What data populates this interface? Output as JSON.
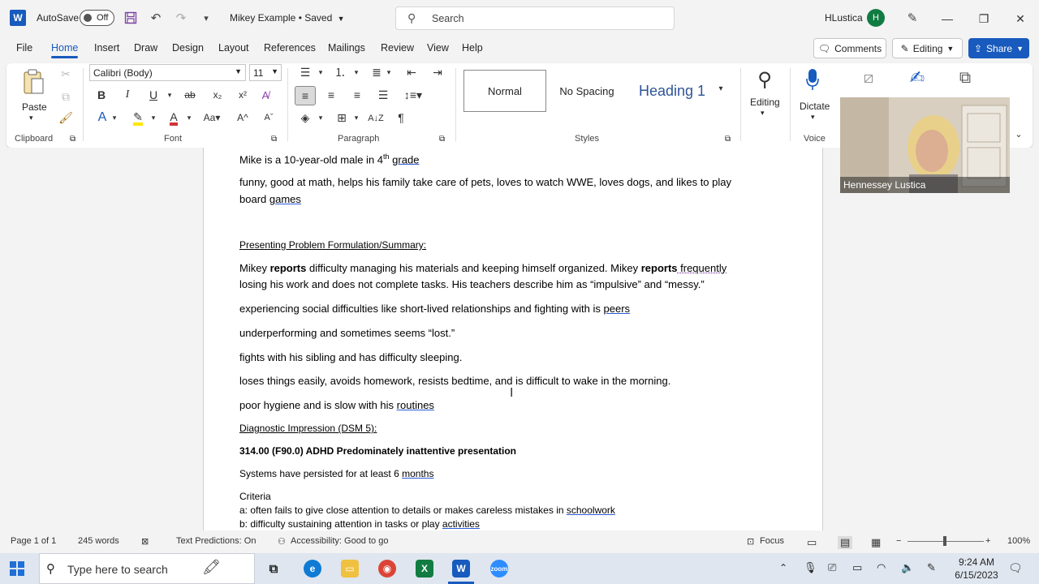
{
  "titlebar": {
    "app_icon": "W",
    "autosave_label": "AutoSave",
    "autosave_state": "Off",
    "doc_title": "Mikey Example • Saved",
    "search_placeholder": "Search",
    "user_name": "HLustica",
    "user_initial": "H"
  },
  "tabs": [
    "File",
    "Home",
    "Insert",
    "Draw",
    "Design",
    "Layout",
    "References",
    "Mailings",
    "Review",
    "View",
    "Help"
  ],
  "active_tab": "Home",
  "actions": {
    "comments": "Comments",
    "editing": "Editing",
    "share": "Share"
  },
  "ribbon": {
    "clipboard": {
      "label": "Clipboard",
      "paste": "Paste"
    },
    "font": {
      "label": "Font",
      "family": "Calibri (Body)",
      "size": "11"
    },
    "paragraph": {
      "label": "Paragraph"
    },
    "styles": {
      "label": "Styles",
      "items": [
        "Normal",
        "No Spacing",
        "Heading 1"
      ]
    },
    "editing": {
      "label": "Editing"
    },
    "voice": {
      "label": "Voice",
      "dictate": "Dictate"
    }
  },
  "document": {
    "line1_pre": "Mike is a 10-year-old male in 4",
    "line1_sup": "th",
    "line1_post": "grade",
    "line2a": "funny, good at math, helps his family take care of pets, loves to watch WWE, loves dogs, and likes to play",
    "line2b_pre": "board ",
    "line2b_sq": "games",
    "heading_presenting": "Presenting Problem Formulation/Summary:",
    "p1_a": "Mikey ",
    "p1_b": "reports",
    "p1_c": " difficulty managing his materials and keeping himself organized. Mikey ",
    "p1_d": "reports",
    "p1_e": " frequently",
    "p1_line2": "losing his work and does not complete tasks. His teachers describe him as “impulsive” and “messy.”",
    "p2_pre": "experiencing social difficulties like short-lived relationships and fighting with is ",
    "p2_sq": "peers",
    "p3": "underperforming and sometimes seems “lost.”",
    "p4": "fights with his sibling and has difficulty sleeping.",
    "p5": "loses things easily, avoids homework, resists bedtime, and is difficult to wake in the morning.",
    "p6_pre": "poor hygiene and is slow with his ",
    "p6_sq": "routines",
    "heading_diag": "Diagnostic Impression (DSM 5):",
    "diag": "314.00 (F90.0) ADHD Predominately inattentive presentation",
    "sys_pre": "Systems have persisted for at least 6 ",
    "sys_sq": "months",
    "criteria": "Criteria",
    "crit_a_pre": "a: often fails to give close attention to details or makes careless mistakes in ",
    "crit_a_sq": "schoolwork",
    "crit_b_pre": "b: difficulty sustaining attention in tasks or play ",
    "crit_b_sq": "activities"
  },
  "video": {
    "participant": "Hennessey Lustica"
  },
  "statusbar": {
    "page": "Page 1 of 1",
    "words": "245 words",
    "predictions": "Text Predictions: On",
    "accessibility": "Accessibility: Good to go",
    "focus": "Focus",
    "zoom": "100%"
  },
  "taskbar": {
    "search_placeholder": "Type here to search",
    "time": "9:24 AM",
    "date": "6/15/2023"
  }
}
